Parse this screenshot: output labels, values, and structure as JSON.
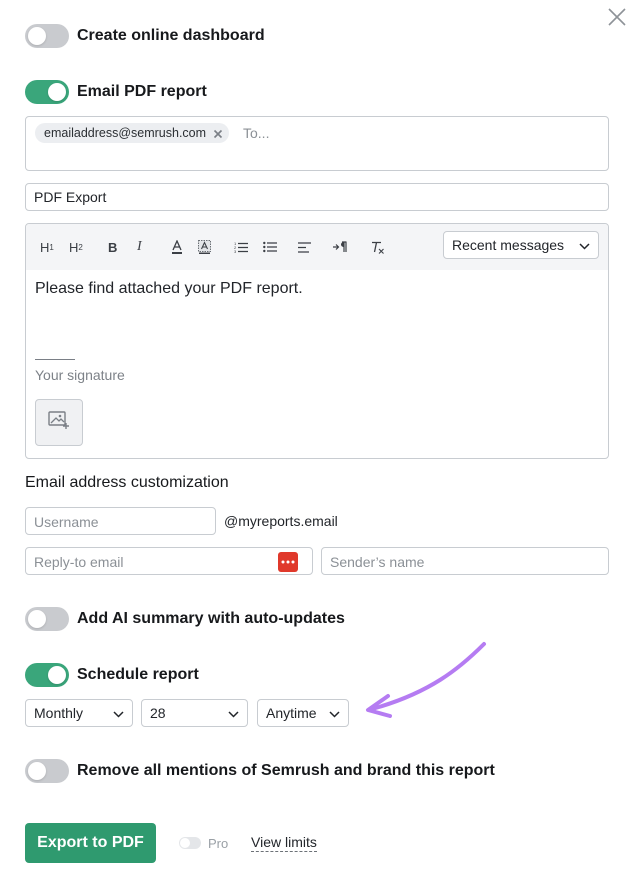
{
  "toggles": {
    "online_dashboard": {
      "label": "Create online dashboard",
      "on": false
    },
    "email_pdf": {
      "label": "Email PDF report",
      "on": true
    },
    "ai_summary": {
      "label": "Add AI summary with auto-updates",
      "on": false
    },
    "schedule": {
      "label": "Schedule report",
      "on": true
    },
    "remove_mentions": {
      "label": "Remove all mentions of Semrush and brand this report",
      "on": false
    }
  },
  "recipients": {
    "chips": [
      "emailaddress@semrush.com"
    ],
    "placeholder": "To..."
  },
  "subject": {
    "value": "PDF Export"
  },
  "editor": {
    "toolbar": [
      "H1",
      "H2",
      "B",
      "I",
      "text-color",
      "highlight",
      "ordered-list",
      "bullet-list",
      "align-left",
      "paragraph",
      "clear-format"
    ],
    "recent_label": "Recent messages",
    "body": "Please find attached your PDF report.",
    "signature_placeholder": "Your signature"
  },
  "customization": {
    "title": "Email address customization",
    "username_placeholder": "Username",
    "domain": "@myreports.email",
    "reply_placeholder": "Reply-to email",
    "sender_placeholder": "Sender’s name"
  },
  "schedule": {
    "frequency": "Monthly",
    "day": "28",
    "time": "Anytime"
  },
  "footer": {
    "export_label": "Export to PDF",
    "pro_label": "Pro",
    "view_limits_label": "View limits"
  },
  "colors": {
    "toggle_on": "#3aa67b",
    "export_button": "#2f9a6f",
    "reply_icon": "#e0392b",
    "annotation_arrow": "#b57cf2"
  }
}
